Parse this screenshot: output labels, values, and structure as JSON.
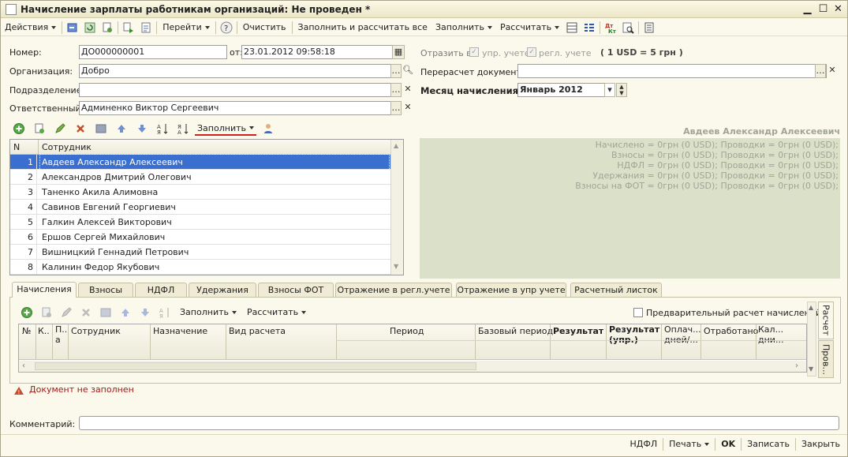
{
  "window": {
    "title": "Начисление зарплаты работникам организаций: Не проведен *"
  },
  "toolbar": {
    "actions": "Действия",
    "goto": "Перейти",
    "clear": "Очистить",
    "fill_calc_all": "Заполнить и рассчитать все",
    "fill": "Заполнить",
    "calculate": "Рассчитать"
  },
  "form": {
    "number_label": "Номер:",
    "number_value": "ДО000000001",
    "date_label": "от:",
    "date_value": "23.01.2012 09:58:18",
    "org_label": "Организация:",
    "org_value": "Добро",
    "dept_label": "Подразделение:",
    "dept_value": "",
    "resp_label": "Ответственный:",
    "resp_value": "Админенко Виктор Сергеевич",
    "reflect_label": "Отразить в:",
    "reflect_mgmt": "упр. учете",
    "reflect_reg": "регл. учете",
    "rate": "( 1 USD = 5 грн )",
    "recalc_label": "Перерасчет документа:",
    "recalc_value": "",
    "month_label": "Месяц начисления:",
    "month_value": "Январь 2012"
  },
  "employees": {
    "fill_label": "Заполнить",
    "col_n": "N",
    "col_employee": "Сотрудник",
    "rows": [
      {
        "n": "1",
        "name": "Авдеев Александр Алексеевич"
      },
      {
        "n": "2",
        "name": "Александров Дмитрий Олегович"
      },
      {
        "n": "3",
        "name": "Таненко Акила Алимовна"
      },
      {
        "n": "4",
        "name": "Савинов Евгений Георгиевич"
      },
      {
        "n": "5",
        "name": "Галкин Алексей Викторович"
      },
      {
        "n": "6",
        "name": "Ершов Сергей Михайлович"
      },
      {
        "n": "7",
        "name": "Вишницкий Геннадий Петрович"
      },
      {
        "n": "8",
        "name": "Калинин Федор Якубович"
      }
    ]
  },
  "summary": {
    "employee": "Авдеев Александр Алексеевич",
    "lines": [
      "Начислено = 0грн (0 USD);   Проводки = 0грн (0 USD);",
      "Взносы = 0грн (0 USD);   Проводки = 0грн (0 USD);",
      "НДФЛ = 0грн (0 USD);   Проводки = 0грн (0 USD);",
      "Удержания = 0грн (0 USD);   Проводки = 0грн (0 USD);",
      "Взносы на ФОТ = 0грн (0 USD);   Проводки = 0грн (0 USD);"
    ]
  },
  "tabs": [
    "Начисления",
    "Взносы",
    "НДФЛ",
    "Удержания",
    "Взносы ФОТ",
    "Отражение в регл.учете",
    "Отражение в упр учете",
    "Расчетный листок"
  ],
  "accruals": {
    "fill": "Заполнить",
    "calculate": "Рассчитать",
    "prelim_label": "Предварительный расчет начислений",
    "cols": {
      "num": "№",
      "k": "К..",
      "p": "П.. а",
      "employee": "Сотрудник",
      "purpose": "Назначение",
      "calc_type": "Вид расчета",
      "period": "Период",
      "base_period": "Базовый период",
      "result": "Результат",
      "result_mgmt": "Результат (упр.)",
      "paid": "Оплач... дней/...",
      "worked": "Отработано",
      "cal": "Кал... дни..."
    },
    "side_tab_calc": "Расчет",
    "side_tab_post": "Пров..."
  },
  "status": {
    "not_filled": "Документ не заполнен"
  },
  "comment": {
    "label": "Комментарий:",
    "value": ""
  },
  "bottom": {
    "ndfl": "НДФЛ",
    "print": "Печать",
    "ok": "OK",
    "save": "Записать",
    "close": "Закрыть"
  },
  "colors": {
    "selection": "#3a6fcf",
    "panel": "#dbe1c8",
    "summary_text": "#a0a496"
  }
}
